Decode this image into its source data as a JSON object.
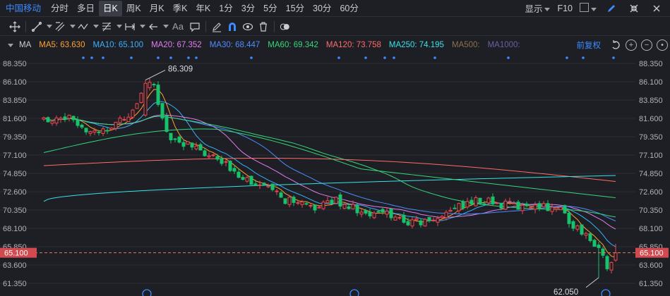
{
  "period_bar": {
    "stock_name": "中国移动",
    "tabs": [
      "分时",
      "多日",
      "日K",
      "周K",
      "月K",
      "季K",
      "年K",
      "1分",
      "3分",
      "5分",
      "15分",
      "30分",
      "60分"
    ],
    "active_tab": "日K",
    "display_label": "显示",
    "f10_label": "F10"
  },
  "icons": {
    "tools": [
      "crosshair-icon",
      "line-tool-icon",
      "channel-tool-icon",
      "wave-tool-icon",
      "fibonacci-tool-icon",
      "range-tool-icon",
      "arrow-tool-icon",
      "text-tool-icon",
      "comment-tool-icon",
      "eraser-icon",
      "magnet-icon",
      "eye-icon",
      "trash-icon",
      "toggle-icon"
    ],
    "text_tool_label": "Aa"
  },
  "ma_bar": {
    "label": "MA",
    "items": [
      {
        "text": "MA5: 63.630",
        "color": "#ffa033"
      },
      {
        "text": "MA10: 65.100",
        "color": "#3ab0ff"
      },
      {
        "text": "MA20: 67.352",
        "color": "#e37cf2"
      },
      {
        "text": "MA30: 68.447",
        "color": "#4f8cff"
      },
      {
        "text": "MA60: 69.342",
        "color": "#37d67a"
      },
      {
        "text": "MA120: 73.758",
        "color": "#ff6b6b"
      },
      {
        "text": "MA250: 74.195",
        "color": "#38e2e8"
      },
      {
        "text": "MA500:",
        "color": "#8a7150"
      },
      {
        "text": "MA1000:",
        "color": "#6f5ca8"
      }
    ],
    "adjust_label": "前复权"
  },
  "colors": {
    "up": "#f0464e",
    "down": "#18c26a",
    "grid": "#2b2e35",
    "current_line": "#d9805a",
    "badge": "#d14a4f"
  },
  "chart_data": {
    "type": "candlestick",
    "y_ticks": [
      "88.350",
      "86.100",
      "83.850",
      "81.600",
      "79.350",
      "77.100",
      "74.850",
      "72.600",
      "70.350",
      "68.100",
      "65.850",
      "63.600",
      "61.350"
    ],
    "ylim": [
      61.35,
      88.35
    ],
    "current_price": "65.100",
    "annotations": {
      "high": "86.309",
      "low": "62.050"
    },
    "ma5_last": 63.63,
    "ma10_last": 65.1,
    "ma20_last": 67.352,
    "ma30_last": 68.447,
    "ma60_last": 69.342,
    "ma120_last": 73.758,
    "ma250_last": 74.195
  }
}
